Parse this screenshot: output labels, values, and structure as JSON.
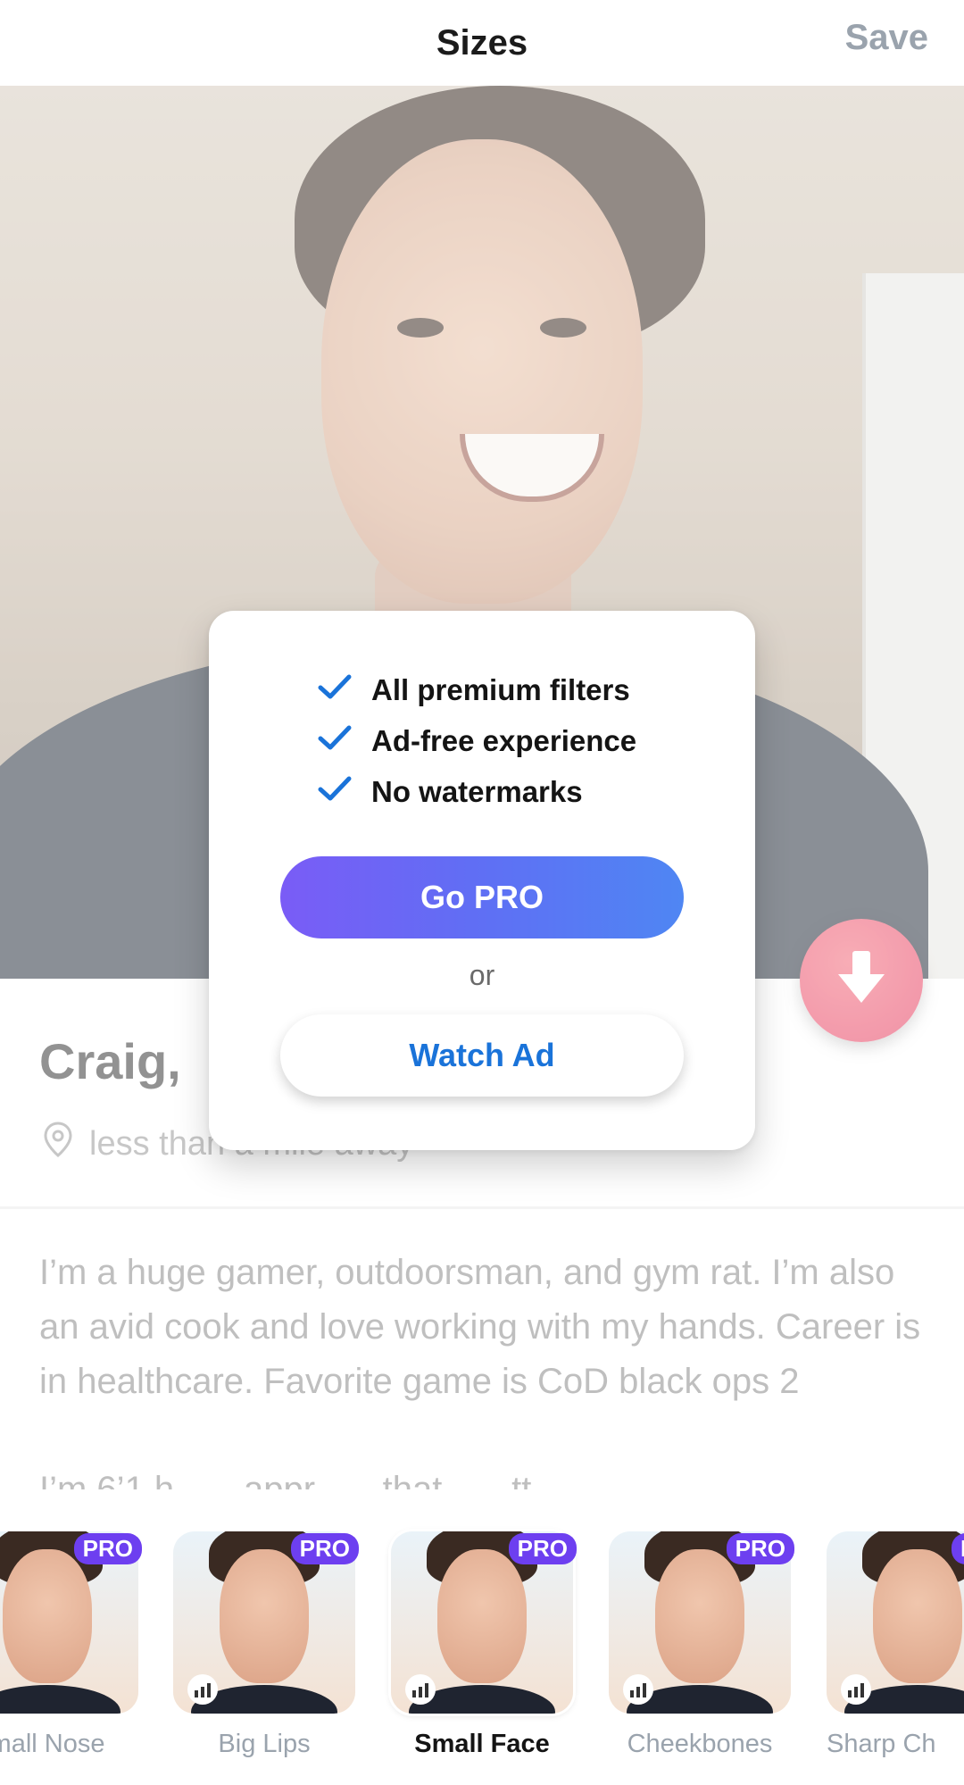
{
  "header": {
    "title": "Sizes",
    "save_label": "Save"
  },
  "profile": {
    "name": "Craig,",
    "location": "less than a mile away",
    "bio": "I’m a huge gamer, outdoorsman, and gym rat. I’m also an avid cook and love working with my hands. Career is in healthcare. Favorite game is CoD black ops 2",
    "bio_more": "I’m 6’1 h... ...appr... ...that... ...tt..."
  },
  "paywall": {
    "features": [
      "All premium filters",
      "Ad-free experience",
      "No watermarks"
    ],
    "go_pro_label": "Go PRO",
    "or_label": "or",
    "watch_ad_label": "Watch Ad",
    "accent": "#6d3ff0",
    "check_color": "#1a73d9"
  },
  "filters": [
    {
      "label": "mall Nose",
      "pro": "PRO",
      "selected": false
    },
    {
      "label": "Big Lips",
      "pro": "PRO",
      "selected": false
    },
    {
      "label": "Small Face",
      "pro": "PRO",
      "selected": true
    },
    {
      "label": "Cheekbones",
      "pro": "PRO",
      "selected": false
    },
    {
      "label": "Sharp Ch",
      "pro": "P",
      "selected": false
    }
  ]
}
